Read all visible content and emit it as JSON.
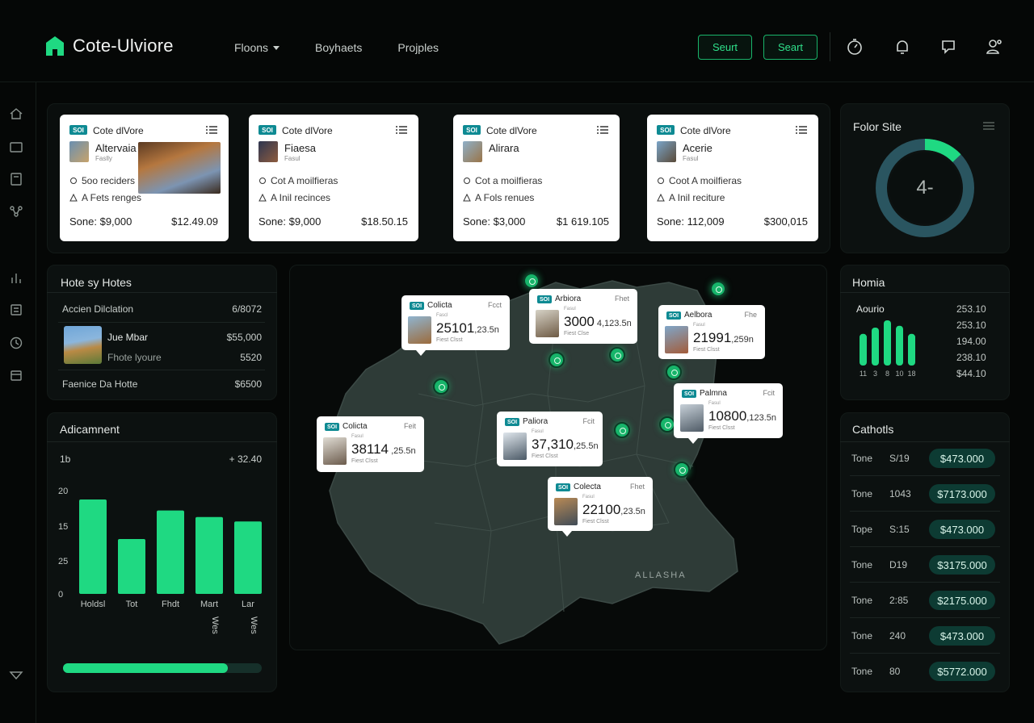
{
  "header": {
    "brand": "Cote-Ulviore",
    "nav": [
      {
        "label": "Floons",
        "dropdown": true
      },
      {
        "label": "Boyhaets",
        "dropdown": false
      },
      {
        "label": "Projples",
        "dropdown": false
      }
    ],
    "buttons": [
      "Seurt",
      "Seart"
    ],
    "icons": [
      "timer-icon",
      "bell-icon",
      "chat-icon",
      "user-settings-icon"
    ]
  },
  "sidebar": {
    "icons": [
      "home-icon",
      "folder-icon",
      "document-icon",
      "network-icon",
      "chart-icon",
      "list-icon",
      "clock-icon",
      "calendar-icon",
      "collapse-icon"
    ]
  },
  "hotel_cards": [
    {
      "brand": "Cote dlVore",
      "name": "Altervaia",
      "sub": "Faslly",
      "line1": "5oo reciders",
      "line2": "A Fets renges",
      "some": "Sone: $9,000",
      "price": "$12.49.09"
    },
    {
      "brand": "Cote dlVore",
      "name": "Fiaesa",
      "sub": "Fasul",
      "line1": "Cot A moilfieras",
      "line2": "A Inil recinces",
      "some": "Sone: $9,000",
      "price": "$18.50.15"
    },
    {
      "brand": "Cote dlVore",
      "name": "Alirara",
      "sub": "",
      "line1": "Cot a moilfieras",
      "line2": "A Fols renues",
      "some": "Sone: $3,000",
      "price": "$1 619.105"
    },
    {
      "brand": "Cote dlVore",
      "name": "Acerie",
      "sub": "Fasul",
      "line1": "Coot A moilfieras",
      "line2": "A Inil reciture",
      "some": "Sone: 112,009",
      "price": "$300,015"
    }
  ],
  "color_site": {
    "title": "Folor Site",
    "value": "4-",
    "fraction": 0.13
  },
  "hotels_list": {
    "title": "Hote sy Hotes",
    "rows": [
      {
        "label": "Accien Dilclation",
        "sub": "",
        "value": "6/8072"
      },
      {
        "label": "Jue Mbar",
        "sub": "Fhote lyoure",
        "value": "$55,000",
        "value2": "5520"
      },
      {
        "label": "Faenice Da Hotte",
        "sub": "",
        "value": "$6500"
      }
    ]
  },
  "adicamnent": {
    "title": "Adicamnent",
    "top_left": "1b",
    "top_right": "+ 32.40",
    "progress": 0.83
  },
  "chart_data": {
    "type": "bar",
    "title": "Adicamnent",
    "categories": [
      "Holdsl",
      "Tot",
      "Fhdt",
      "Mart",
      "Lar"
    ],
    "sub_labels": [
      "",
      "",
      "",
      "Wes",
      "Wes"
    ],
    "values": [
      21.5,
      12.5,
      19,
      17.5,
      16.5
    ],
    "y_ticks": [
      "20",
      "15",
      "25",
      "0"
    ],
    "ylim": [
      0,
      25
    ]
  },
  "map": {
    "region_label": "ALLASHA",
    "cards": [
      {
        "name": "Colicta",
        "right": "Fcct",
        "value": "25101",
        "suffix": ",23.5n",
        "sub": "Fascl",
        "bottom": "Fiest Clsst"
      },
      {
        "name": "Arbiora",
        "right": "Fhet",
        "value": "3000",
        "suffix": " 4,123.5n",
        "sub": "Fasul",
        "bottom": "Fiest Clse"
      },
      {
        "name": "Aelbora",
        "right": "Fhe",
        "value": "21991",
        "suffix": ",259n",
        "sub": "Fasul",
        "bottom": "Fiest Clsst"
      },
      {
        "name": "Palmna",
        "right": "Fcit",
        "value": "10800",
        "suffix": ",123.5n",
        "sub": "Fasul",
        "bottom": "Fiest Clsst"
      },
      {
        "name": "Colicta",
        "right": "Feit",
        "value": "38114",
        "suffix": " ,25.5n",
        "sub": "Fasul",
        "bottom": "Fiest Clsst"
      },
      {
        "name": "Paliora",
        "right": "Fcit",
        "value": "37,310",
        "suffix": ",25.5n",
        "sub": "Fasul",
        "bottom": "Fiest Clsst"
      },
      {
        "name": "Colecta",
        "right": "Fhet",
        "value": "22100",
        "suffix": ",23.5n",
        "sub": "Fasul",
        "bottom": "Fiest Clsst"
      }
    ]
  },
  "homia": {
    "title": "Homia",
    "sub": "Aourio",
    "values": [
      "253.10",
      "253.10",
      "194.00",
      "238.10",
      "$44.10"
    ],
    "bar_labels": [
      "11",
      "3",
      "8",
      "10",
      "18"
    ],
    "bar_levels": [
      0.7,
      0.84,
      1.0,
      0.88,
      0.7
    ]
  },
  "cathotls": {
    "title": "Cathotls",
    "rows": [
      {
        "a": "Tone",
        "b": "S/19",
        "amount": "$473.000"
      },
      {
        "a": "Tone",
        "b": "1043",
        "amount": "$7173.000"
      },
      {
        "a": "Tope",
        "b": "S:15",
        "amount": "$473.000"
      },
      {
        "a": "Tone",
        "b": "D19",
        "amount": "$3175.000"
      },
      {
        "a": "Tone",
        "b": "2:85",
        "amount": "$2175.000"
      },
      {
        "a": "Tone",
        "b": "240",
        "amount": "$473.000"
      },
      {
        "a": "Tone",
        "b": "80",
        "amount": "$5772.000"
      }
    ]
  },
  "colors": {
    "accent": "#1fd982",
    "panel": "#0c1110",
    "pill": "#0d3b33",
    "map": "#2e3b37"
  }
}
